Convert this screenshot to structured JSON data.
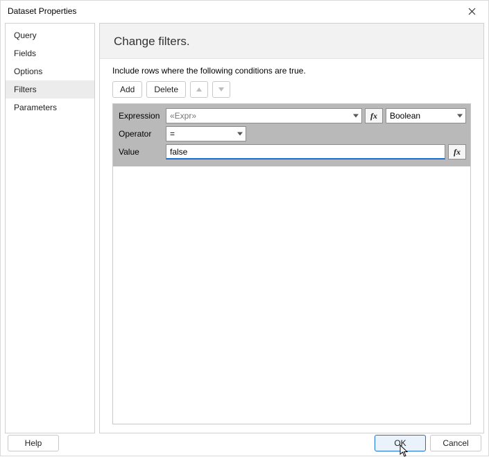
{
  "dialog": {
    "title": "Dataset Properties"
  },
  "sidebar": {
    "items": [
      {
        "label": "Query",
        "selected": false
      },
      {
        "label": "Fields",
        "selected": false
      },
      {
        "label": "Options",
        "selected": false
      },
      {
        "label": "Filters",
        "selected": true
      },
      {
        "label": "Parameters",
        "selected": false
      }
    ]
  },
  "main": {
    "heading": "Change filters.",
    "instruction": "Include rows where the following conditions are true.",
    "toolbar": {
      "add": "Add",
      "delete": "Delete"
    },
    "form": {
      "labels": {
        "expression": "Expression",
        "operator": "Operator",
        "value": "Value"
      },
      "expression": {
        "placeholder": "«Expr»",
        "value": ""
      },
      "type": {
        "value": "Boolean"
      },
      "operator": {
        "value": "="
      },
      "value_field": {
        "value": "false"
      },
      "fx_label": "fx"
    }
  },
  "footer": {
    "help": "Help",
    "ok": "OK",
    "cancel": "Cancel"
  }
}
